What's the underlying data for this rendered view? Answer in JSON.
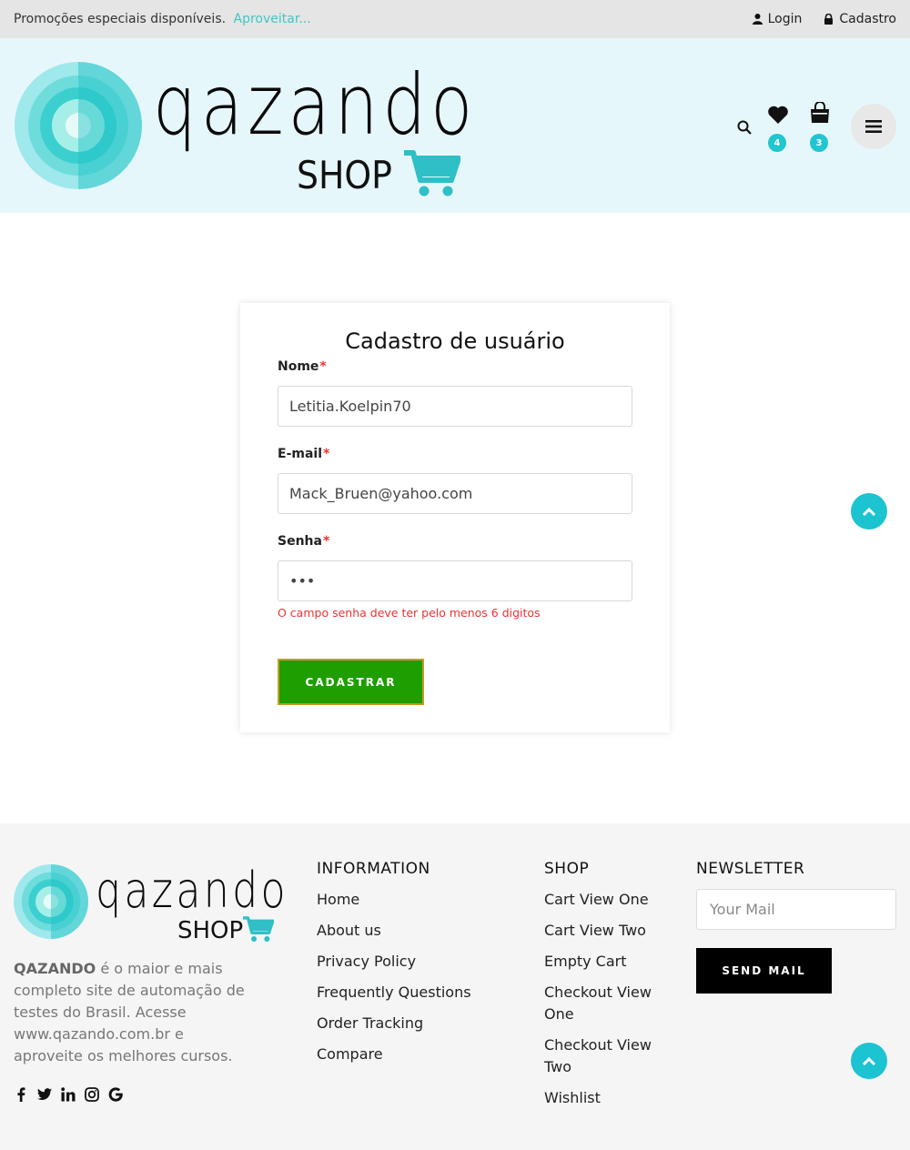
{
  "topbar": {
    "promo_text": "Promoções especiais disponíveis.",
    "promo_link": "Aproveitar...",
    "login_label": "Login",
    "register_label": "Cadastro"
  },
  "header": {
    "logo_text": "qazando",
    "logo_sub": "SHOP",
    "wishlist_count": "4",
    "cart_count": "3"
  },
  "form": {
    "title": "Cadastro de usuário",
    "name_label": "Nome",
    "name_value": "Letitia.Koelpin70",
    "email_label": "E-mail",
    "email_value": "Mack_Bruen@yahoo.com",
    "password_label": "Senha",
    "password_value": "•••",
    "required_mark": "*",
    "error_text": "O campo senha deve ter pelo menos 6 digitos",
    "submit_label": "CADASTRAR"
  },
  "footer": {
    "logo_text": "qazando",
    "logo_sub": "SHOP",
    "about_brand": "QAZANDO",
    "about_text": " é o maior e mais completo site de automação de testes do Brasil. Acesse www.qazando.com.br e aproveite os melhores cursos.",
    "info_title": "INFORMATION",
    "info_links": [
      "Home",
      "About us",
      "Privacy Policy",
      "Frequently Questions",
      "Order Tracking",
      "Compare"
    ],
    "shop_title": "SHOP",
    "shop_links": [
      "Cart View One",
      "Cart View Two",
      "Empty Cart",
      "Checkout View One",
      "Checkout View Two",
      "Wishlist"
    ],
    "newsletter_title": "NEWSLETTER",
    "newsletter_placeholder": "Your Mail",
    "newsletter_button": "SEND MAIL"
  },
  "colors": {
    "accent": "#1cc3d0",
    "header_bg": "#e6f7fc",
    "submit_bg": "#1e9e00",
    "error": "#e33333"
  }
}
